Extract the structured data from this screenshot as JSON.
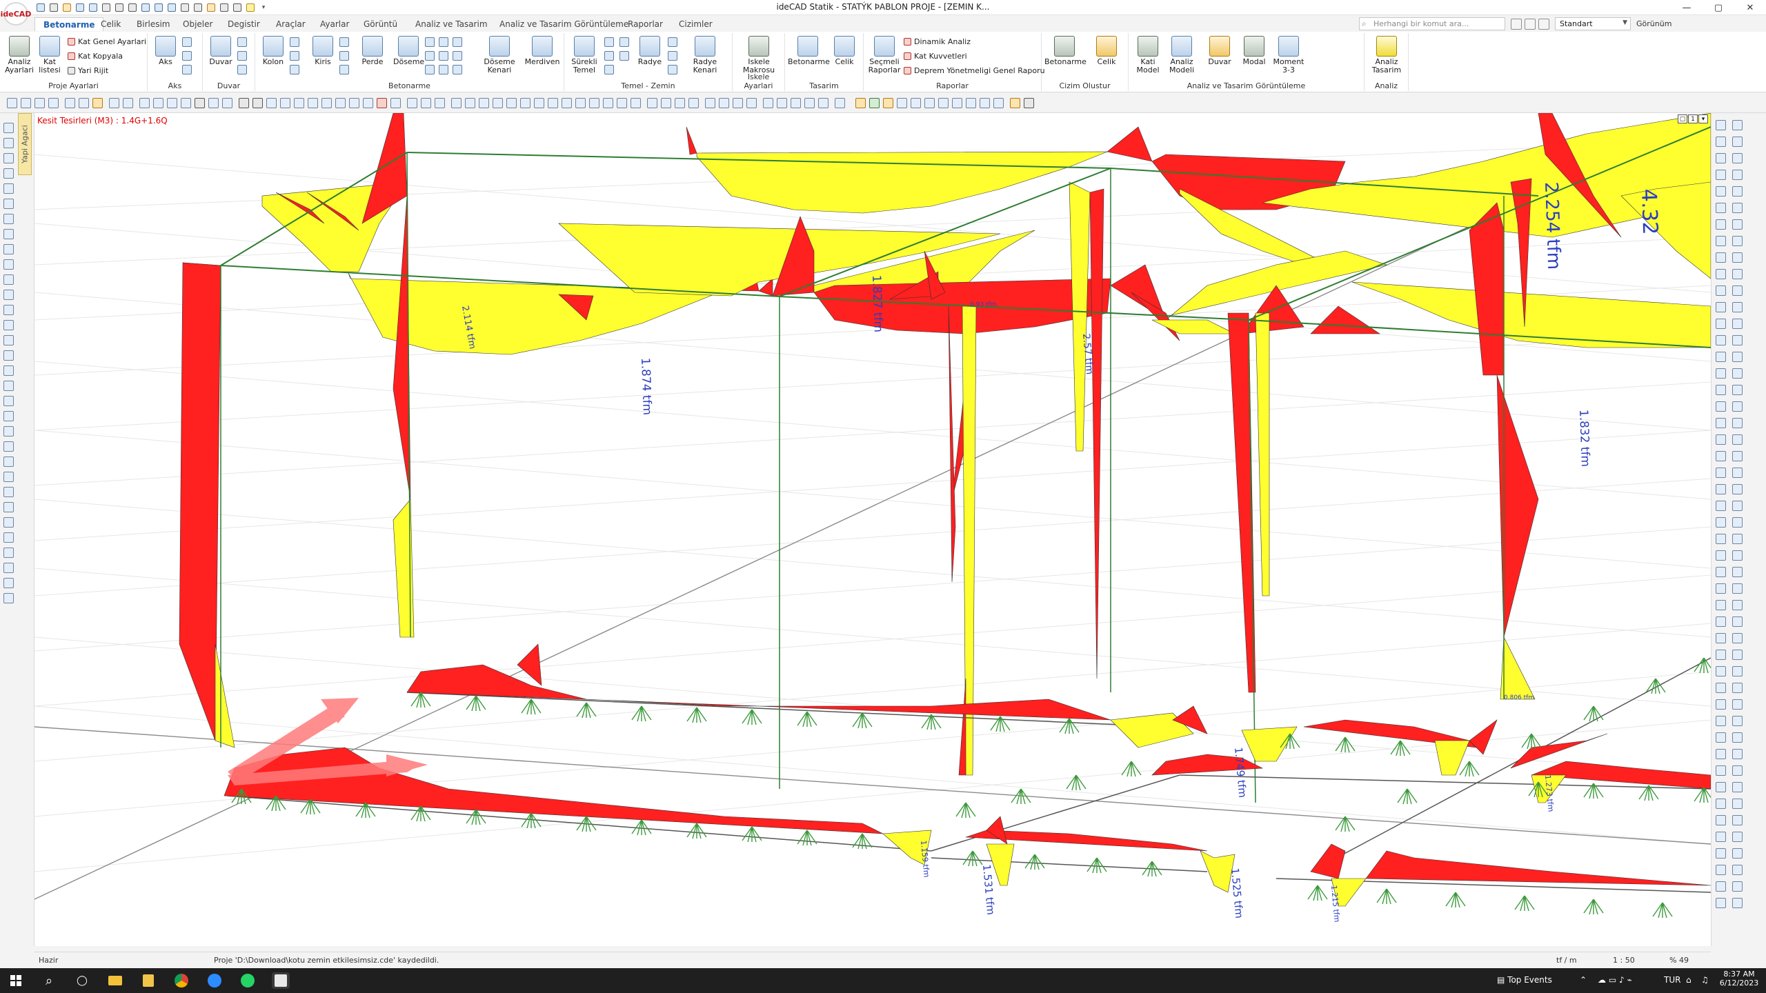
{
  "app": {
    "title": "ideCAD Statik - STATÝK ÞABLON PROJE - [ZEMIN K...",
    "logo": "ideCAD"
  },
  "window_controls": [
    "—",
    "▢",
    "✕"
  ],
  "tabs": [
    "Betonarme",
    "Celik",
    "Birlesim",
    "Objeler",
    "Degistir",
    "Araçlar",
    "Ayarlar",
    "Görüntü",
    "Analiz ve Tasarim",
    "Analiz ve Tasarim Görüntüleme",
    "Raporlar",
    "Cizimler"
  ],
  "active_tab": "Betonarme",
  "search": {
    "placeholder": "Herhangi bir komut ara..."
  },
  "style_select": {
    "value": "Standart"
  },
  "view_label": "Görünüm",
  "ribbon": {
    "proje": {
      "label": "Proje Ayarlari",
      "analiz": "Analiz Ayarlari",
      "katlist": "Kat listesi",
      "kgen": "Kat Genel Ayarlari",
      "kkop": "Kat Kopyala",
      "yrijit": "Yari Rijit"
    },
    "aks": {
      "label": "Aks",
      "btn": "Aks"
    },
    "duvar": {
      "label": "Duvar",
      "btn": "Duvar"
    },
    "betonarme": {
      "label": "Betonarme",
      "kolon": "Kolon",
      "kiris": "Kiris",
      "perde": "Perde",
      "doseme": "Döseme",
      "dkenar": "Döseme Kenari",
      "merdiven": "Merdiven"
    },
    "temel": {
      "label": "Temel - Zemin",
      "surekli": "Sürekli Temel",
      "radye": "Radye",
      "rkenar": "Radye Kenari"
    },
    "iskele": {
      "label": "Iskele Ayarlari",
      "btn": "Iskele Makrosu"
    },
    "tasarim": {
      "label": "Tasarim",
      "bet": "Betonarme",
      "cel": "Celik"
    },
    "raporlar": {
      "label": "Raporlar",
      "secmeli": "Seçmeli Raporlar",
      "dinamik": "Dinamik Analiz",
      "kat": "Kat Kuvvetleri",
      "deprem": "Deprem Yönetmeligi Genel Raporu"
    },
    "cizim": {
      "label": "Cizim Olustur",
      "bet": "Betonarme",
      "cel": "Celik"
    },
    "gorunt": {
      "label": "Analiz ve Tasarim Görüntüleme",
      "kati": "Kati Model",
      "analiz": "Analiz Modeli",
      "duvar": "Duvar",
      "modal": "Modal",
      "moment": "Moment 3-3"
    },
    "analiz": {
      "label": "Analiz",
      "btn": "Analiz Tasarim"
    }
  },
  "left_panel_tab": "Yapi Agaci",
  "viewport": {
    "title": "Kesit Tesirleri (M3) : 1.4G+1.6Q",
    "labels": [
      "1.827 tfm",
      "1.874 tfm",
      "1.832 tfm",
      "2.114 tfm",
      "2.57 tfm",
      "2.254 tfm",
      "4.32",
      "1.749 tfm",
      "1.531 tfm",
      "1.525 tfm",
      "1.159 tfm",
      "1.215 tfm",
      "1.273 tfm",
      "0.93 tfm",
      "0.806 tfm"
    ],
    "colors": {
      "negative": "#ff2020",
      "positive": "#ffff30",
      "member": "#2e7d32",
      "support": "#3b9a3b",
      "axis": "#ff6b6b"
    }
  },
  "status": {
    "ready": "Hazir",
    "message": "Proje 'D:\\Download\\kotu zemin etkilesimsiz.cde' kaydedildi.",
    "unit": "tf / m",
    "scale": "1 : 50",
    "zoom": "% 49"
  },
  "taskbar": {
    "weather": "Top Events",
    "lang": "TUR",
    "time": "8:37 AM",
    "date": "6/12/2023"
  }
}
